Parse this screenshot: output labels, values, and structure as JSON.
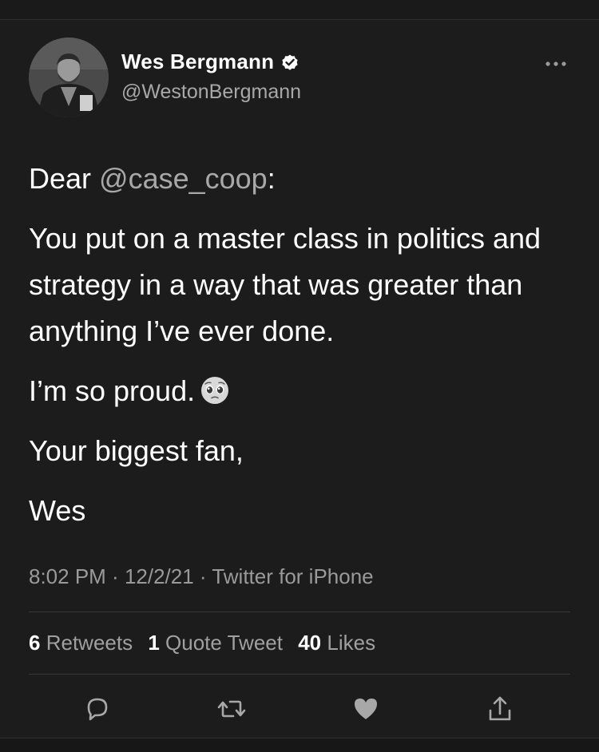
{
  "tweet": {
    "author": {
      "display_name": "Wes Bergmann",
      "handle": "@WestonBergmann",
      "verified": true
    },
    "body": {
      "dear": "Dear ",
      "mention": "@case_coop",
      "dear_suffix": ":",
      "line1": "You put on a master class in politics and strategy in a way that was greater than anything I’ve ever done.",
      "line2": "I’m so proud.",
      "line3": "Your biggest fan,",
      "line4": "Wes"
    },
    "meta": {
      "time": "8:02 PM",
      "date": "12/2/21",
      "source": "Twitter for iPhone",
      "separator": " · "
    },
    "stats": {
      "retweets_count": "6",
      "retweets_label": "Retweets",
      "quote_count": "1",
      "quote_label": "Quote Tweet",
      "likes_count": "40",
      "likes_label": "Likes"
    },
    "actions": [
      "reply-icon",
      "retweet-icon",
      "like-icon",
      "share-icon"
    ]
  },
  "colors": {
    "background": "#1c1c1c",
    "text": "#ffffff",
    "secondary": "#a8a8a8",
    "divider": "#383838"
  }
}
